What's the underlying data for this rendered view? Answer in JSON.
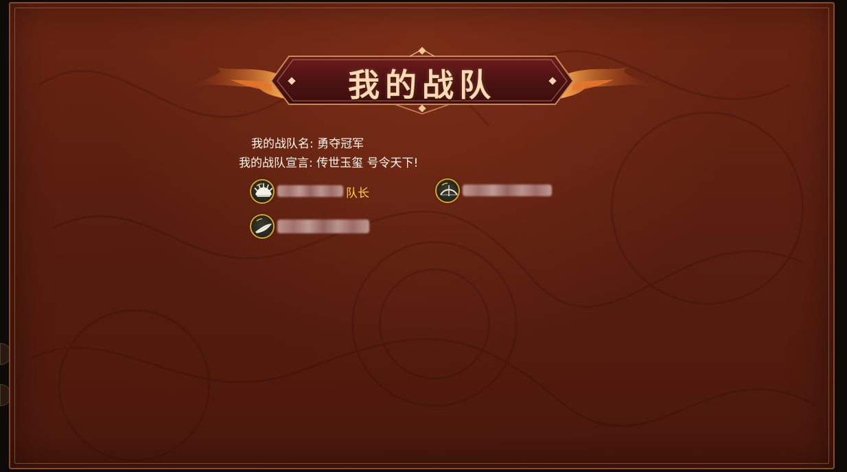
{
  "title": "我的战队",
  "team": {
    "name_label": "我的战队名:",
    "name_value": "勇夺冠军",
    "slogan_label": "我的战队宣言:",
    "slogan_value": "传世玉玺 号令天下!"
  },
  "members": [
    {
      "avatar_icon": "hedgehog-icon",
      "role": "队长"
    },
    {
      "avatar_icon": "bow-icon",
      "role": ""
    },
    {
      "avatar_icon": "feather-icon",
      "role": ""
    }
  ],
  "colors": {
    "panel_bg": "#5a1f10",
    "title_text": "#f7dcb4",
    "captain_label": "#ffd43a",
    "avatar_ring": "#d9a424"
  }
}
